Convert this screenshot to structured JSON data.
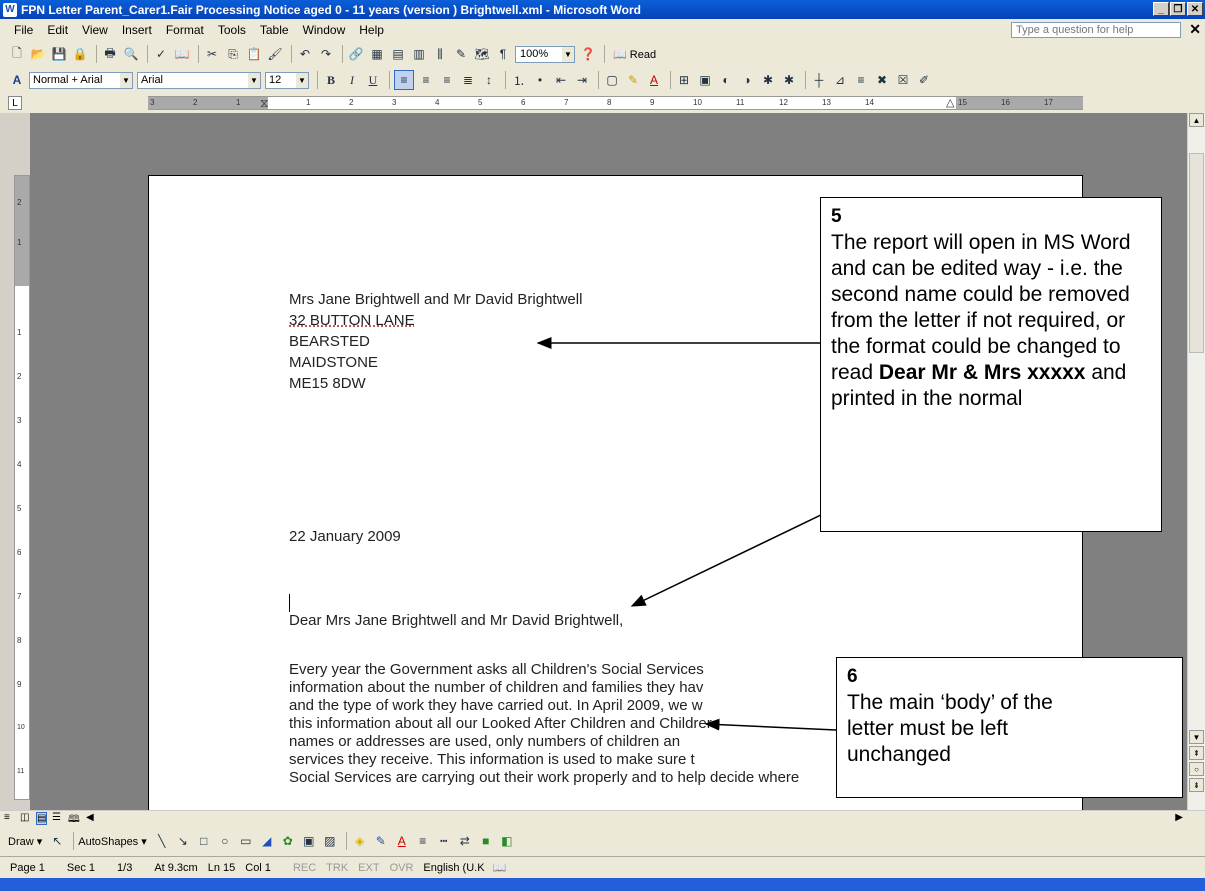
{
  "window": {
    "title": "FPN Letter Parent_Carer1.Fair Processing Notice aged 0 - 11 years (version )  Brightwell.xml - Microsoft Word",
    "app_icon": "W"
  },
  "menu": {
    "items": [
      "File",
      "Edit",
      "View",
      "Insert",
      "Format",
      "Tools",
      "Table",
      "Window",
      "Help"
    ],
    "help_placeholder": "Type a question for help"
  },
  "toolbar": {
    "zoom": "100%",
    "read_label": "Read",
    "style": "Normal + Arial",
    "font": "Arial",
    "size": "12"
  },
  "ruler": {
    "h_ticks": [
      "3",
      "2",
      "1",
      "1",
      "2",
      "3",
      "4",
      "5",
      "6",
      "7",
      "8",
      "9",
      "10",
      "11",
      "12",
      "13",
      "14",
      "15",
      "16",
      "17"
    ],
    "v_ticks": [
      "2",
      "1",
      "1",
      "2",
      "3",
      "4",
      "5",
      "6",
      "7",
      "8",
      "9",
      "10",
      "11"
    ]
  },
  "document": {
    "address": [
      "Mrs Jane Brightwell and Mr David Brightwell",
      "32 BUTTON LANE",
      "BEARSTED",
      "MAIDSTONE",
      "ME15 8DW"
    ],
    "date": "22 January 2009",
    "salutation": "Dear Mrs Jane Brightwell and Mr David Brightwell,",
    "body_lines": [
      "Every year the Government asks all Children's Social Services",
      "information about the number of children and families they hav",
      "and the type of work they have carried out.  In April 2009, we w",
      "this information about all our Looked After Children and Childrer",
      "names or addresses are used, only numbers of children an",
      "services they receive.  This information is used to make sure t",
      "Social Services are carrying out their work properly and to help decide where"
    ]
  },
  "callouts": {
    "c5": {
      "number": "5",
      "text_before": "The report will open in MS Word and can be edited way - i.e. the second name could be removed from the letter if not required, or the format could be changed to read ",
      "text_bold": "Dear Mr & Mrs xxxxx",
      "text_after": " and printed in the normal"
    },
    "c6": {
      "number": "6",
      "text": "The main ‘body’ of the letter must be left unchanged"
    }
  },
  "drawbar": {
    "draw_label": "Draw",
    "autoshapes_label": "AutoShapes"
  },
  "status": {
    "page": "Page 1",
    "sec": "Sec 1",
    "pages": "1/3",
    "at": "At 9.3cm",
    "ln": "Ln 15",
    "col": "Col 1",
    "rec": "REC",
    "trk": "TRK",
    "ext": "EXT",
    "ovr": "OVR",
    "lang": "English (U.K"
  }
}
